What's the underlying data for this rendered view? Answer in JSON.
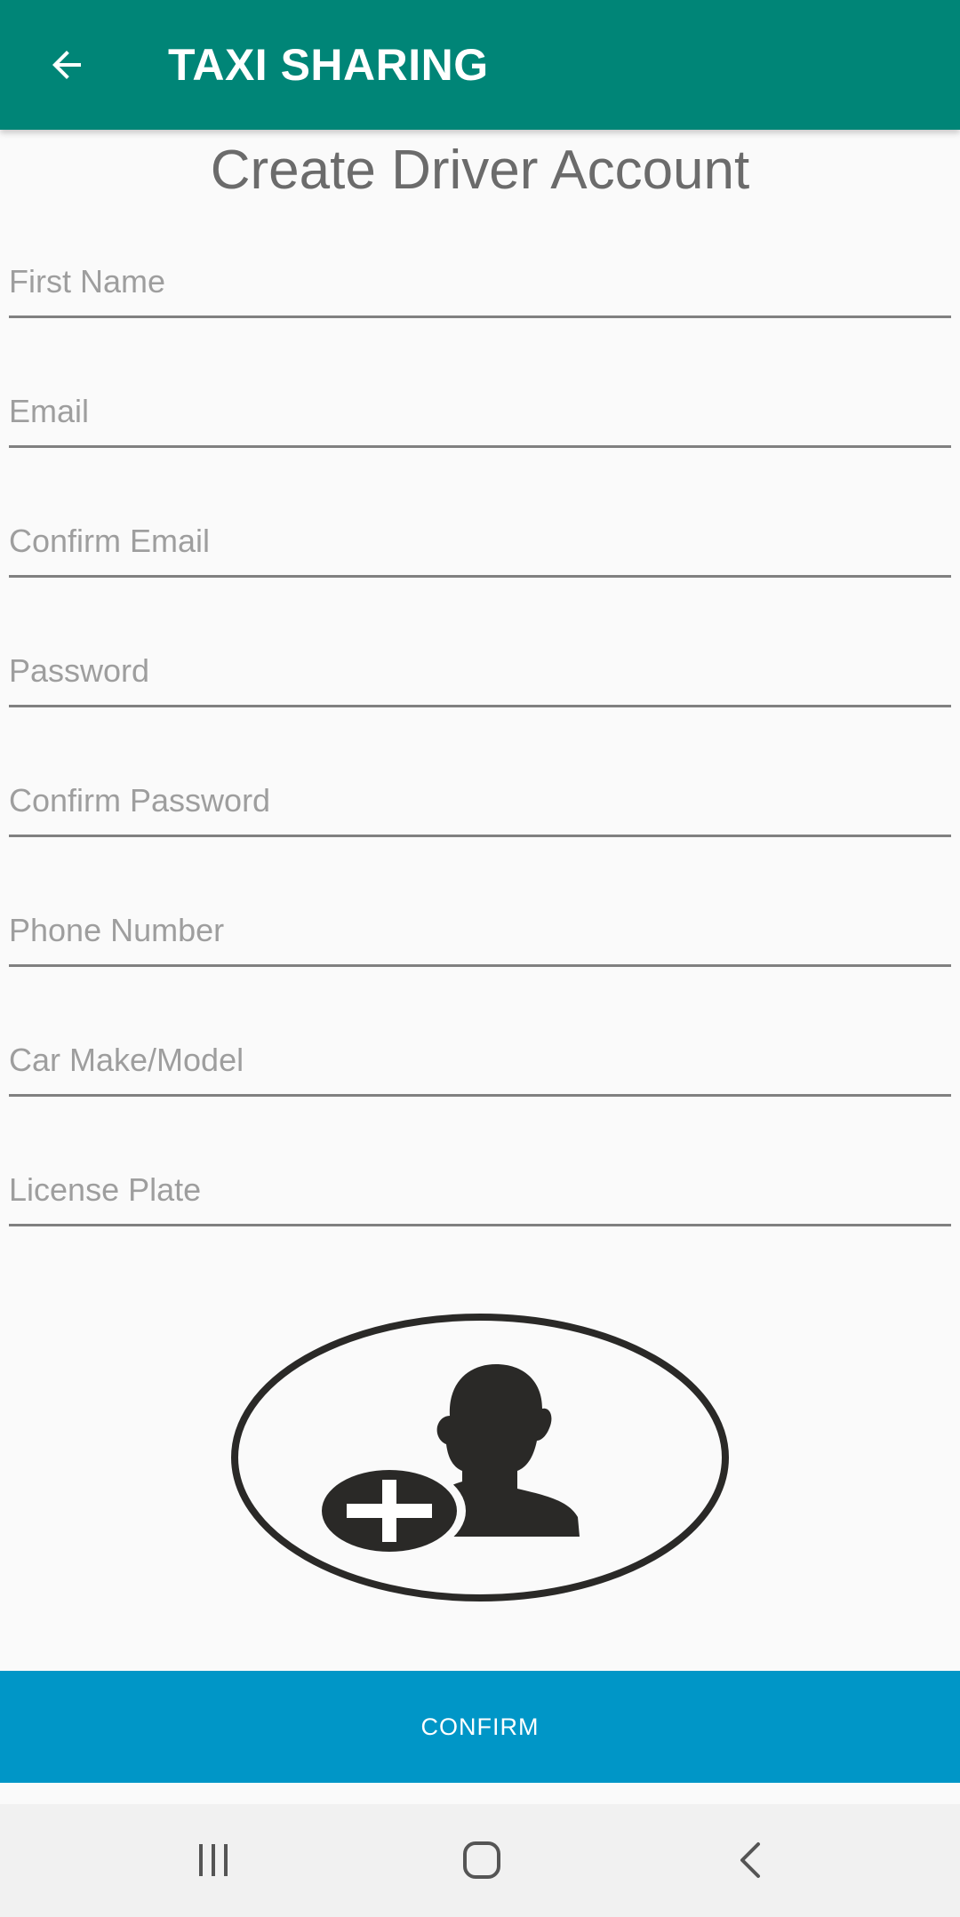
{
  "toolbar": {
    "title": "TAXI SHARING",
    "back_icon": "arrow-left-icon",
    "background_color": "#008577"
  },
  "form": {
    "heading": "Create Driver Account",
    "fields": {
      "first_name": {
        "placeholder": "First Name",
        "value": ""
      },
      "email": {
        "placeholder": "Email",
        "value": ""
      },
      "confirm_email": {
        "placeholder": "Confirm Email",
        "value": ""
      },
      "password": {
        "placeholder": "Password",
        "value": ""
      },
      "confirm_password": {
        "placeholder": "Confirm Password",
        "value": ""
      },
      "phone_number": {
        "placeholder": "Phone Number",
        "value": ""
      },
      "car_make_model": {
        "placeholder": "Car Make/Model",
        "value": ""
      },
      "license_plate": {
        "placeholder": "License Plate",
        "value": ""
      }
    },
    "avatar_icon": "add-user-icon",
    "confirm_label": "CONFIRM",
    "confirm_color": "#0096c7"
  },
  "navbar": {
    "recents_icon": "recents-icon",
    "home_icon": "home-icon",
    "back_icon": "back-chevron-icon"
  }
}
